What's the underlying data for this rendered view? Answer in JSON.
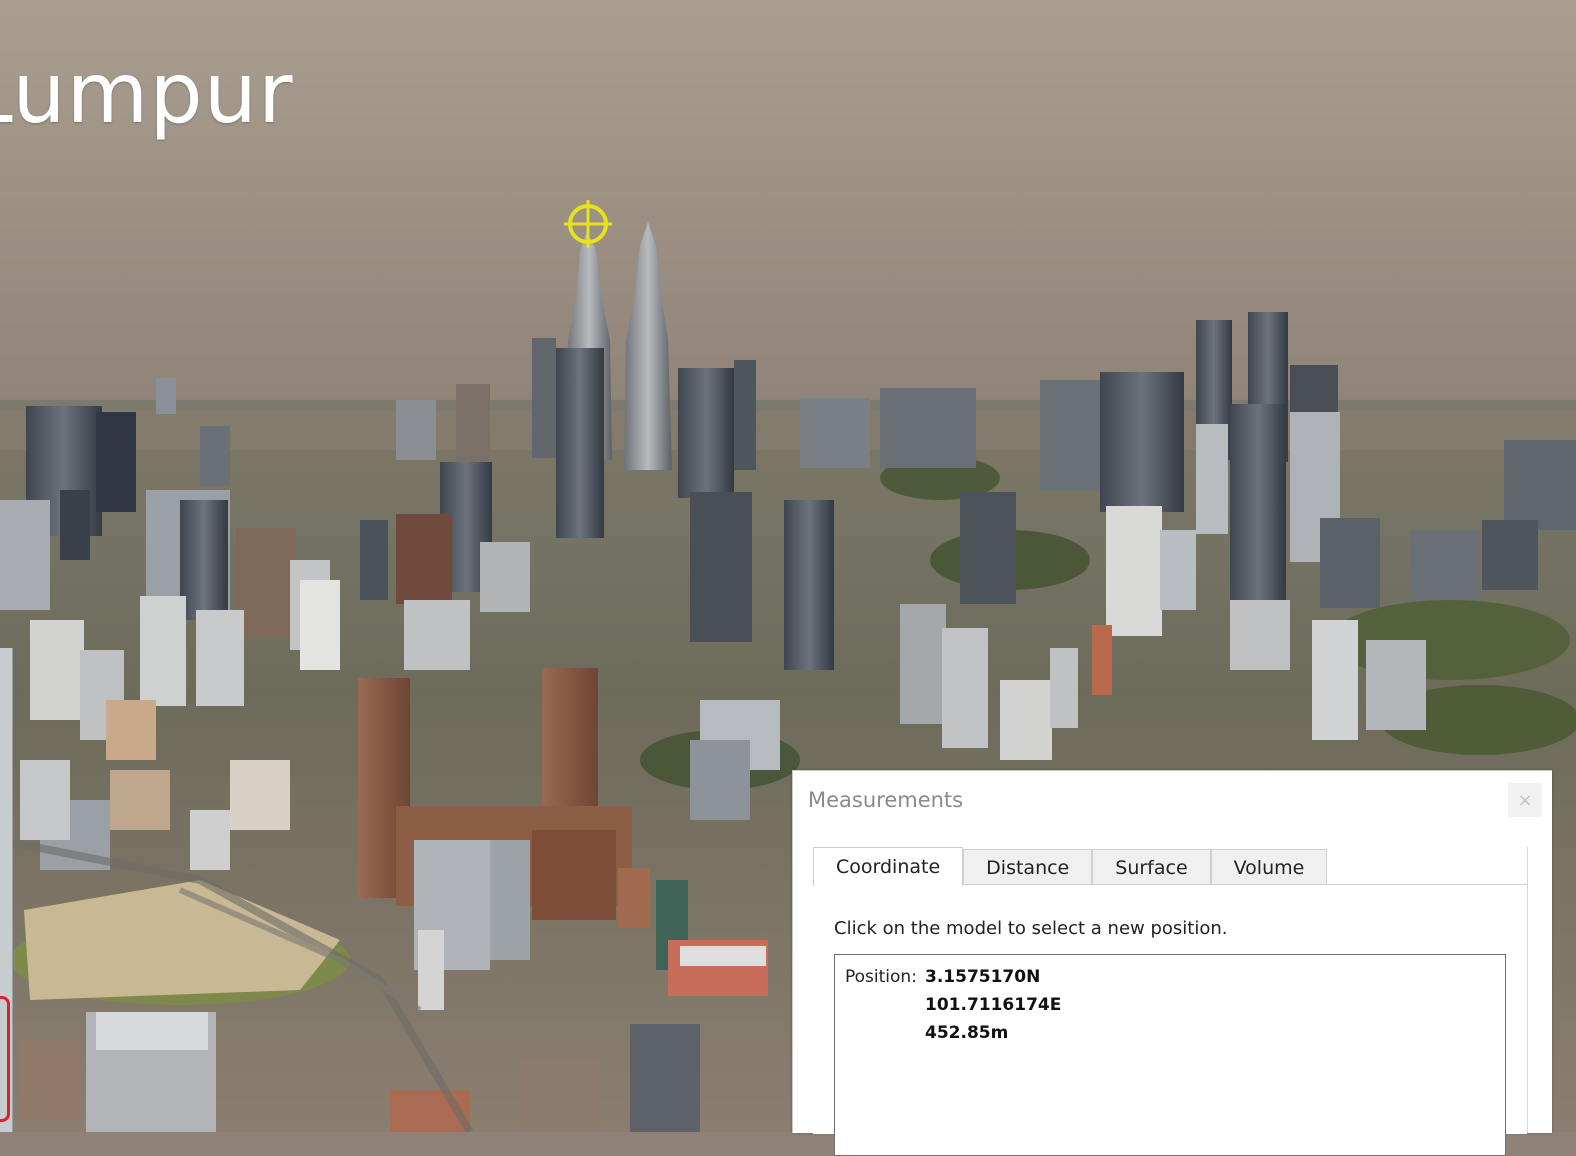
{
  "scene": {
    "title": "Lumpur",
    "sky_colors": [
      "#a99d8f",
      "#8f8377"
    ]
  },
  "measurements_panel": {
    "title": "Measurements",
    "close_label": "×",
    "tabs": [
      {
        "label": "Coordinate",
        "active": true
      },
      {
        "label": "Distance",
        "active": false
      },
      {
        "label": "Surface",
        "active": false
      },
      {
        "label": "Volume",
        "active": false
      }
    ],
    "hint": "Click on the model to select a new position.",
    "position": {
      "label": "Position:",
      "latitude": "3.1575170N",
      "longitude": "101.7116174E",
      "altitude": "452.85m"
    }
  },
  "icons": {
    "target": "crosshair-target-icon",
    "marker_color": "#e6e21c",
    "selection_outline_color": "#d8232a"
  }
}
